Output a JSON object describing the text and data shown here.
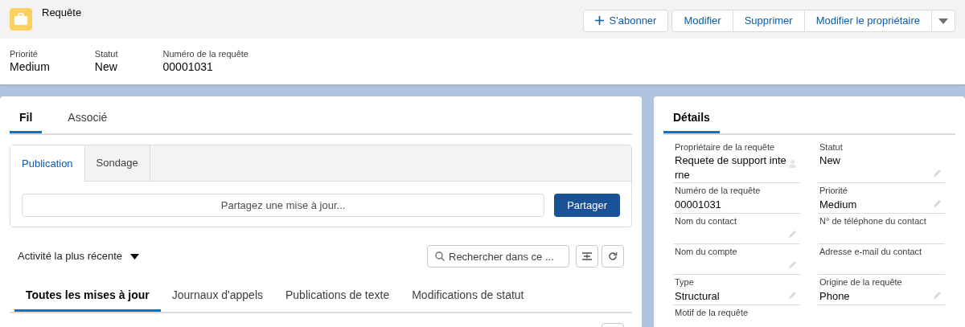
{
  "header": {
    "object_label": "Requête",
    "actions": [
      {
        "label": "S'abonner",
        "kind": "follow"
      },
      {
        "label": "Modifier",
        "kind": "group"
      },
      {
        "label": "Supprimer",
        "kind": "group"
      },
      {
        "label": "Modifier le propriétaire",
        "kind": "group"
      },
      {
        "kind": "menu"
      }
    ]
  },
  "highlights": [
    {
      "label": "Priorité",
      "value": "Medium"
    },
    {
      "label": "Statut",
      "value": "New"
    },
    {
      "label": "Numéro de la requête",
      "value": "00001031"
    }
  ],
  "main_tabs": [
    {
      "label": "Fil",
      "selected": true
    },
    {
      "label": "Associé",
      "selected": false
    }
  ],
  "publisher": {
    "tabs": [
      {
        "label": "Publication",
        "selected": true
      },
      {
        "label": "Sondage",
        "selected": false
      }
    ],
    "placeholder": "Partagez une mise à jour...",
    "share_button": "Partager"
  },
  "feed": {
    "sort": "Activité la plus récente",
    "search_placeholder": "Rechercher dans ce ...",
    "filters": [
      {
        "label": "Toutes les mises à jour",
        "selected": true
      },
      {
        "label": "Journaux d'appels",
        "selected": false
      },
      {
        "label": "Publications de texte",
        "selected": false
      },
      {
        "label": "Modifications de statut",
        "selected": false
      }
    ]
  },
  "details": {
    "tabs": [
      {
        "label": "Détails",
        "selected": true
      }
    ],
    "fields": [
      {
        "label": "Propriétaire de la requête",
        "value": "Requete de support interne",
        "kind": "lookup",
        "editable": true
      },
      {
        "label": "Statut",
        "value": "New",
        "kind": "text",
        "editable": true
      },
      {
        "label": "Numéro de la requête",
        "value": "00001031",
        "kind": "text",
        "editable": false
      },
      {
        "label": "Priorité",
        "value": "Medium",
        "kind": "text",
        "editable": true
      },
      {
        "label": "Nom du contact",
        "kind": "text",
        "editable": true
      },
      {
        "label": "N° de téléphone du contact",
        "kind": "text",
        "editable": false
      },
      {
        "label": "Nom du compte",
        "kind": "text",
        "editable": true
      },
      {
        "label": "Adresse e-mail du contact",
        "kind": "text",
        "editable": false
      },
      {
        "label": "Type",
        "value": "Structural",
        "kind": "text",
        "editable": true
      },
      {
        "label": "Origine de la requête",
        "value": "Phone",
        "kind": "text",
        "editable": true
      },
      {
        "label": "Motif de la requête",
        "kind": "text",
        "editable": false
      }
    ]
  }
}
